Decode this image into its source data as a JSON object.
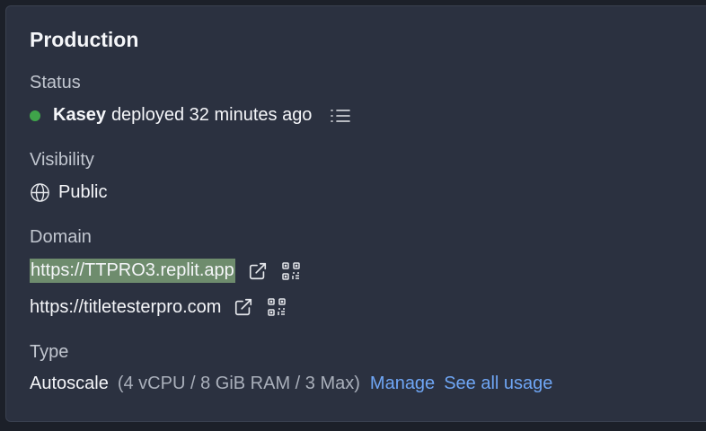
{
  "panel": {
    "title": "Production"
  },
  "status": {
    "label": "Status",
    "user": "Kasey",
    "text": "deployed 32 minutes ago",
    "dot_color": "#3fa44a",
    "log_icon": "list-icon"
  },
  "visibility": {
    "label": "Visibility",
    "value": "Public",
    "icon": "globe-icon"
  },
  "domain": {
    "label": "Domain",
    "items": [
      {
        "url": "https://TTPRO3.replit.app",
        "selected": true,
        "open_icon": "external-link-icon",
        "qr_icon": "qr-code-icon"
      },
      {
        "url": "https://titletesterpro.com",
        "selected": false,
        "open_icon": "external-link-icon",
        "qr_icon": "qr-code-icon"
      }
    ]
  },
  "type": {
    "label": "Type",
    "value": "Autoscale",
    "spec": "(4 vCPU / 8 GiB RAM / 3 Max)",
    "manage_label": "Manage",
    "usage_label": "See all usage"
  },
  "colors": {
    "background": "#1c2029",
    "panel": "#2b3140",
    "link": "#6fa6f5",
    "selection": "#6e8c6d"
  }
}
